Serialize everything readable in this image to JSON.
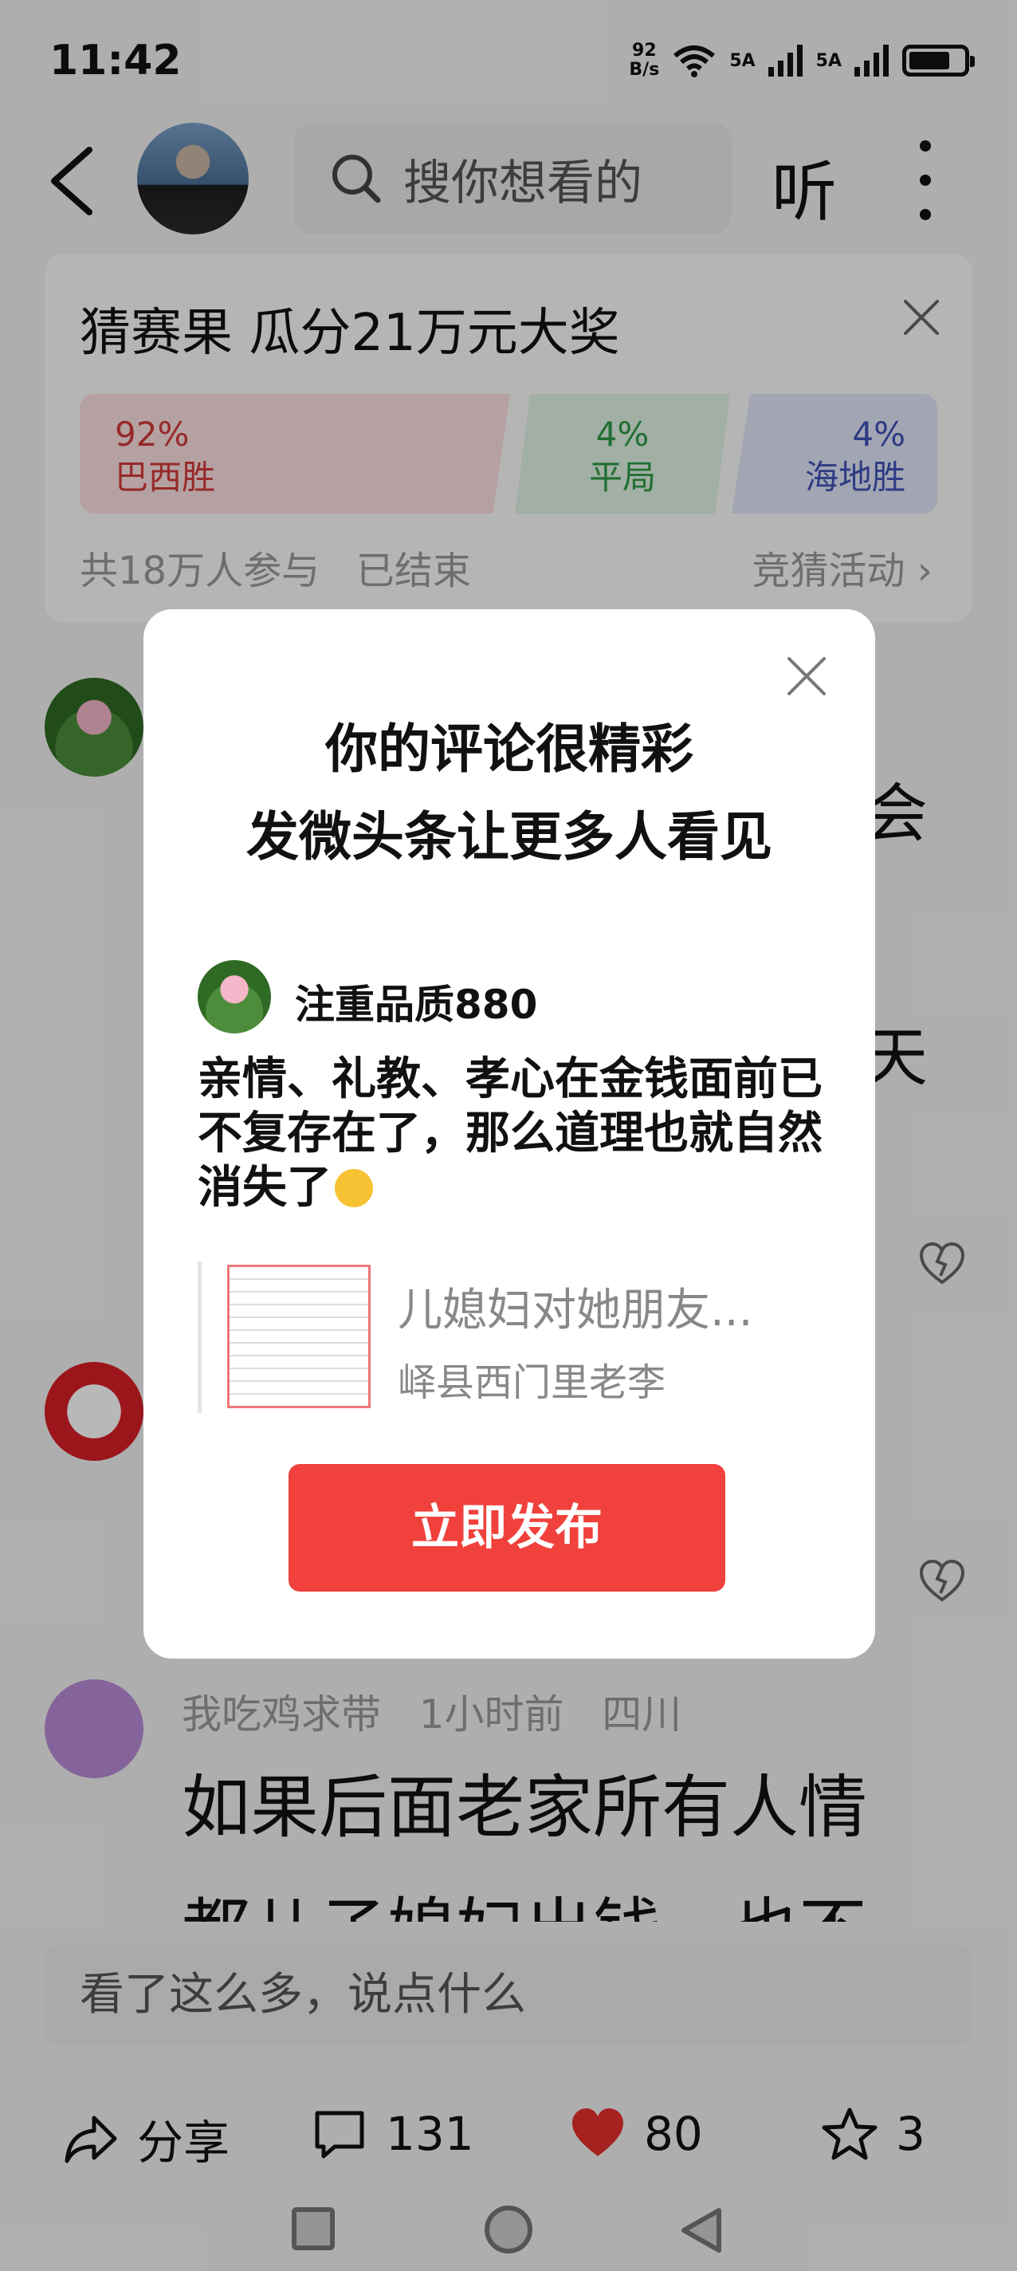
{
  "status_bar": {
    "time": "11:42",
    "net_speed_value": "92",
    "net_speed_unit": "B/s",
    "net_1": "5A",
    "net_2": "5A"
  },
  "nav": {
    "search_placeholder": "搜你想看的",
    "listen_label": "听"
  },
  "prediction": {
    "title": "猜赛果 瓜分21万元大奖",
    "options": [
      {
        "percent": "92%",
        "label": "巴西胜",
        "color": "#d23a3a"
      },
      {
        "percent": "4%",
        "label": "平局",
        "color": "#2f9a46"
      },
      {
        "percent": "4%",
        "label": "海地胜",
        "color": "#4053b8"
      }
    ],
    "participants": "共18万人参与",
    "status": "已结束",
    "link": "竞猜活动"
  },
  "background_comments": {
    "fragment_1": "会",
    "fragment_2": "天",
    "meta_user": "我吃鸡求带",
    "meta_time": "1小时前",
    "meta_location": "四川",
    "text": "如果后面老家所有人情",
    "text_2": "都儿子媳妇出钱，也不"
  },
  "input": {
    "placeholder": "看了这么多，说点什么"
  },
  "actions": {
    "share": "分享",
    "comments": "131",
    "likes": "80",
    "favorites": "3",
    "like_color": "#e5302f"
  },
  "modal": {
    "title_line1": "你的评论很精彩",
    "title_line2": "发微头条让更多人看见",
    "username": "注重品质880",
    "comment": "亲情、礼教、孝心在金钱面前已不复存在了，那么道理也就自然消失了",
    "quote_title": "儿媳妇对她朋友...",
    "quote_author": "峄县西门里老李",
    "publish_button": "立即发布",
    "button_color": "#f0413c"
  }
}
